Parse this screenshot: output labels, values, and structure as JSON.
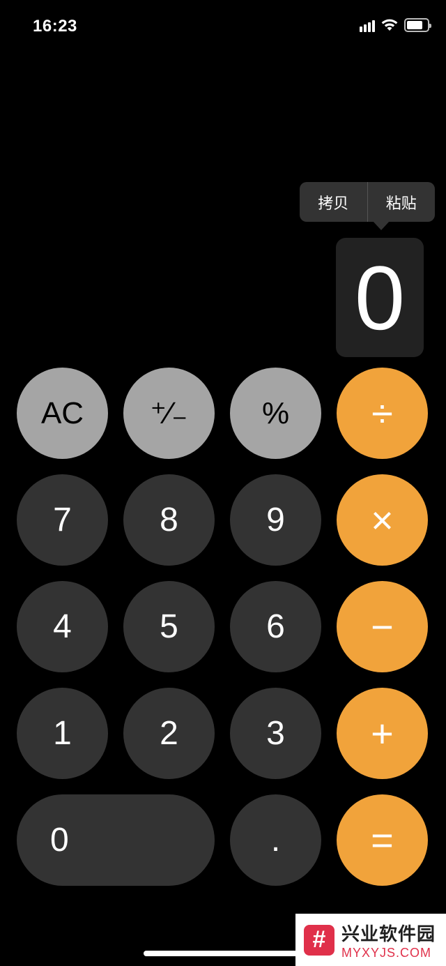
{
  "status_bar": {
    "time": "16:23",
    "icons": [
      "signal-icon",
      "wifi-icon",
      "battery-icon"
    ],
    "battery_level": 0.8
  },
  "context_menu": {
    "copy_label": "拷贝",
    "paste_label": "粘贴"
  },
  "display": {
    "value": "0"
  },
  "keys": {
    "row1": [
      "AC",
      "⁺∕₋",
      "%",
      "÷"
    ],
    "row2": [
      "7",
      "8",
      "9",
      "×"
    ],
    "row3": [
      "4",
      "5",
      "6",
      "−"
    ],
    "row4": [
      "1",
      "2",
      "3",
      "+"
    ],
    "row5": [
      "0",
      ".",
      "="
    ]
  },
  "colors": {
    "background": "#000000",
    "function_key": "#a5a5a5",
    "digit_key": "#333333",
    "operator_key": "#f1a33b"
  },
  "watermark": {
    "logo_glyph": "#",
    "name": "兴业软件园",
    "url": "MYXYJS.COM"
  }
}
